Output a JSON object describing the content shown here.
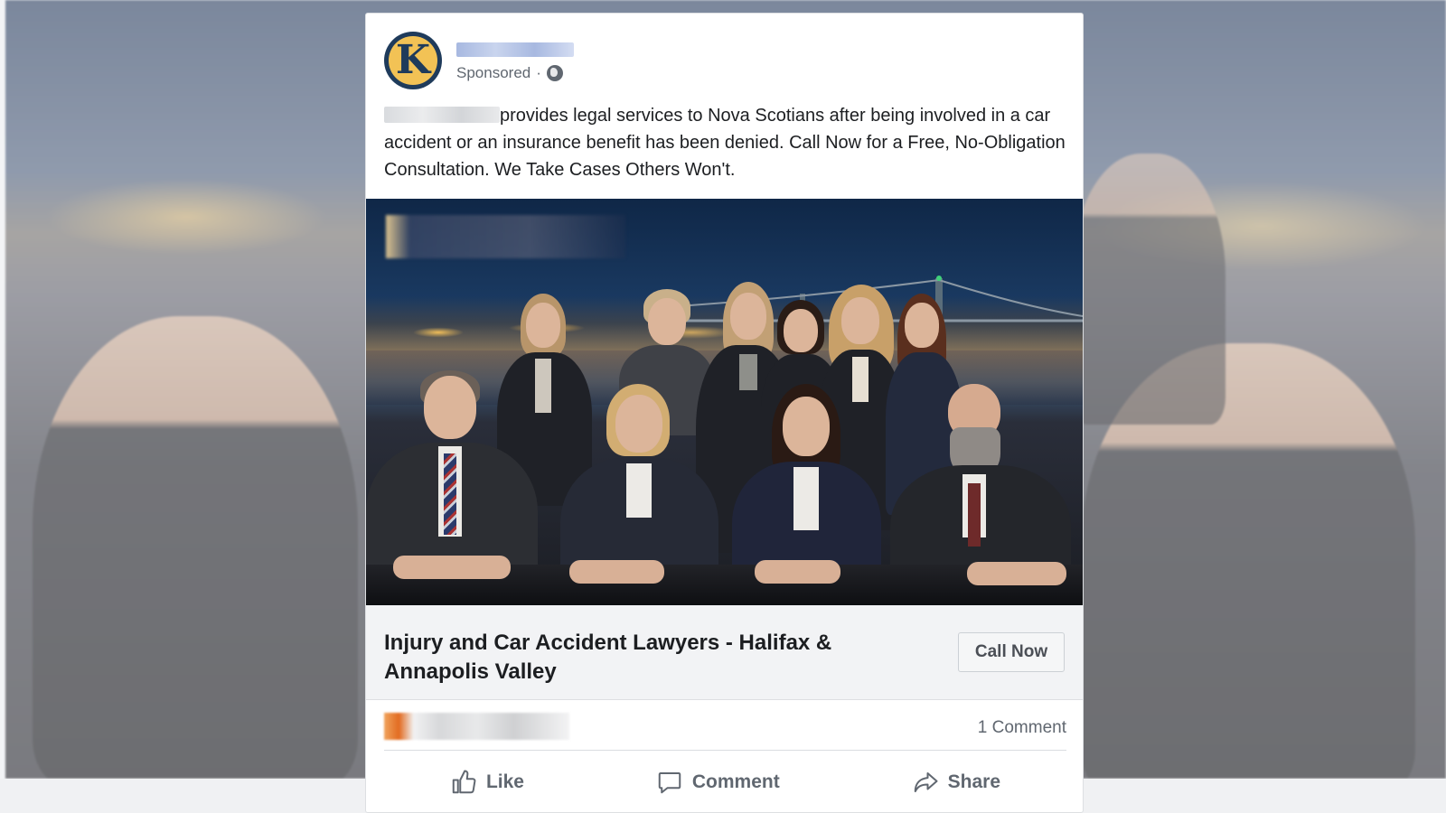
{
  "post": {
    "avatar_letter": "K",
    "sponsored_label": "Sponsored",
    "meta_separator": "·",
    "body_text": "provides legal services to Nova Scotians after being involved in a car accident or an insurance benefit has been denied. Call Now for a Free, No-Obligation Consultation. We Take Cases Others Won't."
  },
  "link": {
    "title": "Injury and Car Accident Lawyers - Halifax & Annapolis Valley",
    "cta_label": "Call Now"
  },
  "engagement": {
    "comment_count": "1 Comment"
  },
  "actions": {
    "like": "Like",
    "comment": "Comment",
    "share": "Share"
  },
  "colors": {
    "card_bg": "#ffffff",
    "text_primary": "#1c1e21",
    "text_secondary": "#606770",
    "linkbar_bg": "#f2f3f5",
    "avatar_navy": "#1f3b5b",
    "avatar_gold": "#f2c255"
  },
  "icons": [
    "globe-icon",
    "like-icon",
    "comment-icon",
    "share-icon"
  ]
}
